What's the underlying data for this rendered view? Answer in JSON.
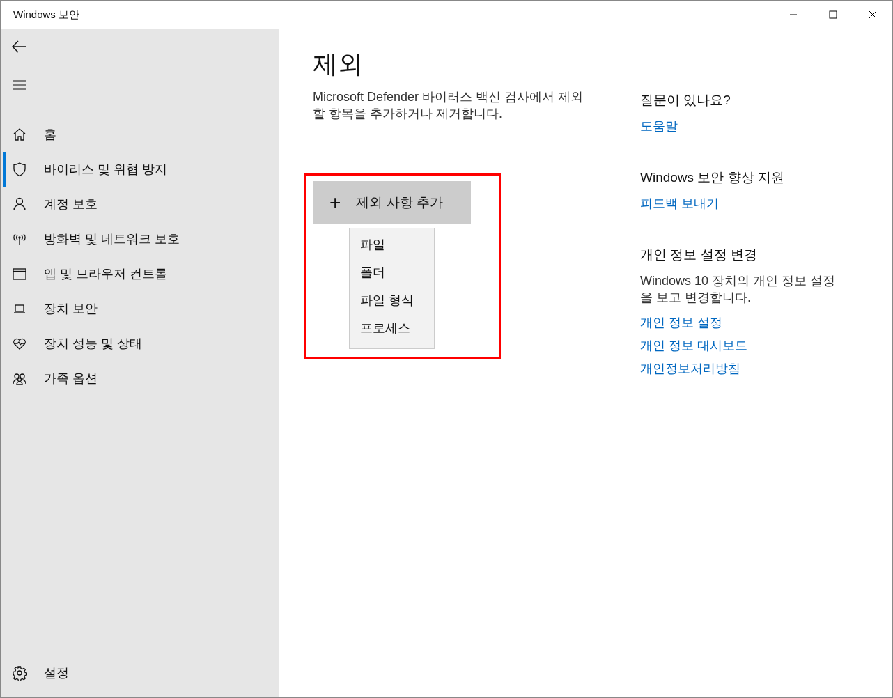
{
  "window": {
    "title": "Windows 보안"
  },
  "sidebar": {
    "items": [
      {
        "label": "홈",
        "kind": "home",
        "selected": false
      },
      {
        "label": "바이러스 및 위협 방지",
        "kind": "shield",
        "selected": true
      },
      {
        "label": "계정 보호",
        "kind": "person",
        "selected": false
      },
      {
        "label": "방화벽 및 네트워크 보호",
        "kind": "antenna",
        "selected": false
      },
      {
        "label": "앱 및 브라우저 컨트롤",
        "kind": "window",
        "selected": false
      },
      {
        "label": "장치 보안",
        "kind": "laptop",
        "selected": false
      },
      {
        "label": "장치 성능 및 상태",
        "kind": "heart",
        "selected": false
      },
      {
        "label": "가족 옵션",
        "kind": "family",
        "selected": false
      }
    ],
    "settings": "설정"
  },
  "page": {
    "title": "제외",
    "description": "Microsoft Defender 바이러스 백신 검사에서 제외할 항목을 추가하거나 제거합니다.",
    "add_button": {
      "icon": "+",
      "label": "제외 사항 추가"
    },
    "menu": [
      "파일",
      "폴더",
      "파일 형식",
      "프로세스"
    ]
  },
  "aside": [
    {
      "heading": "질문이 있나요?",
      "links": [
        "도움말"
      ]
    },
    {
      "heading": "Windows 보안 향상 지원",
      "links": [
        "피드백 보내기"
      ]
    },
    {
      "heading": "개인 정보 설정 변경",
      "text": "Windows 10 장치의 개인 정보 설정을 보고 변경합니다.",
      "links": [
        "개인 정보 설정",
        "개인 정보 대시보드",
        "개인정보처리방침"
      ]
    }
  ]
}
